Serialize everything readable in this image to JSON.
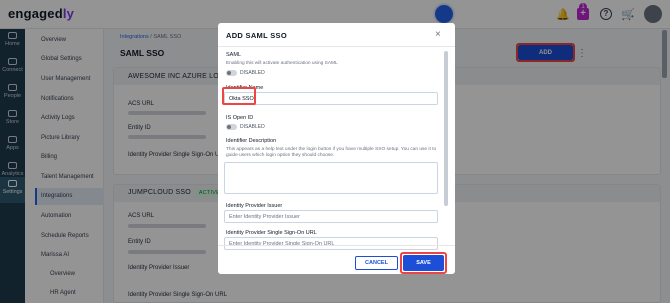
{
  "app": {
    "logo_main": "engaged",
    "logo_accent": "ly"
  },
  "topbar": {
    "notification_count": "1"
  },
  "rail": [
    {
      "label": "Home",
      "icon": "home-icon"
    },
    {
      "label": "Connect",
      "icon": "chat-icon"
    },
    {
      "label": "People",
      "icon": "people-icon"
    },
    {
      "label": "Store",
      "icon": "store-icon"
    },
    {
      "label": "Apps",
      "icon": "apps-icon"
    },
    {
      "label": "Analytics",
      "icon": "analytics-icon"
    },
    {
      "label": "Settings",
      "icon": "gear-icon"
    }
  ],
  "submenu": [
    "Overview",
    "Global Settings",
    "User Management",
    "Notifications",
    "Activity Logs",
    "Picture Library",
    "Billing",
    "Talent Management",
    "Integrations",
    "Automation",
    "Schedule Reports",
    "Marissa AI",
    "Overview",
    "HR Agent"
  ],
  "breadcrumb": {
    "parent": "Integrations",
    "separator": "/",
    "current": "SAML SSO"
  },
  "page": {
    "title": "SAML SSO",
    "add_label": "ADD"
  },
  "cards": [
    {
      "title": "AWESOME INC AZURE LOGIN",
      "fields": [
        "ACS URL",
        "Entity ID",
        "Identity Provider Single Sign-On URL"
      ]
    },
    {
      "title": "JUMPCLOUD SSO",
      "status": "ACTIVE",
      "fields": [
        "ACS URL",
        "Entity ID",
        "Identity Provider Issuer",
        "Identity Provider Single Sign-On URL"
      ]
    }
  ],
  "modal": {
    "title": "ADD SAML SSO",
    "saml_label": "SAML",
    "saml_help": "Enabling this will activate authentication using SAML",
    "saml_toggle_state": "DISABLED",
    "identifier_name_label": "Identifier Name",
    "identifier_name_value": "Okta SSO",
    "is_open_id_label": "IS Open ID",
    "open_id_toggle_state": "DISABLED",
    "identifier_description_label": "Identifier Description",
    "identifier_description_help": "This appears as a help text under the login button if you have multiple SSO setup. You can use it to guide users which login option they should choose.",
    "issuer_label": "Identity Provider Issuer",
    "issuer_placeholder": "Enter Identity Provider Issuer",
    "sso_url_label": "Identity Provider Single Sign-On URL",
    "sso_url_placeholder": "Enter Identity Provider Single Sign-On URL",
    "cancel_label": "CANCEL",
    "save_label": "SAVE"
  }
}
